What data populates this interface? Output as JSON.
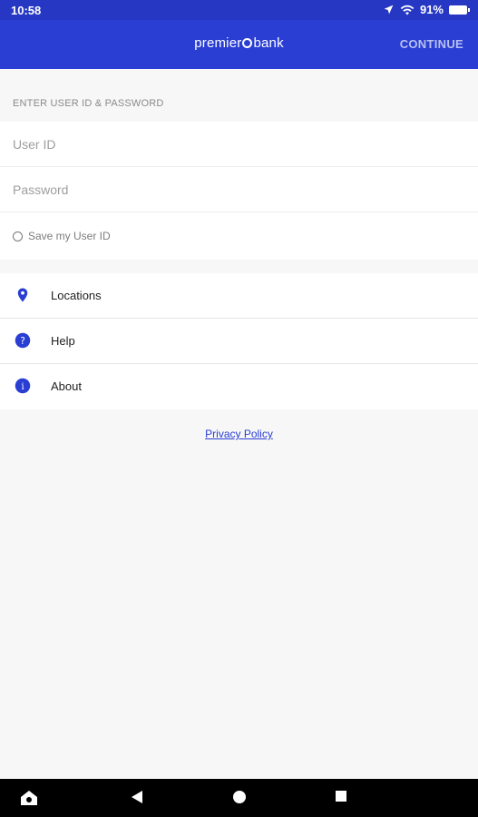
{
  "status": {
    "time": "10:58",
    "battery": "91%"
  },
  "app_bar": {
    "brand_left": "premier",
    "brand_right": "bank",
    "continue_label": "CONTINUE"
  },
  "login": {
    "section_title": "ENTER USER ID & PASSWORD",
    "user_id_placeholder": "User ID",
    "password_placeholder": "Password",
    "save_label": "Save my User ID"
  },
  "menu": {
    "items": [
      {
        "label": "Locations",
        "icon": "location-pin-icon"
      },
      {
        "label": "Help",
        "icon": "question-icon"
      },
      {
        "label": "About",
        "icon": "info-icon"
      }
    ]
  },
  "privacy_label": "Privacy Policy",
  "colors": {
    "primary": "#2a3ed4",
    "status_bar": "#2637c4",
    "background": "#f7f7f7"
  }
}
